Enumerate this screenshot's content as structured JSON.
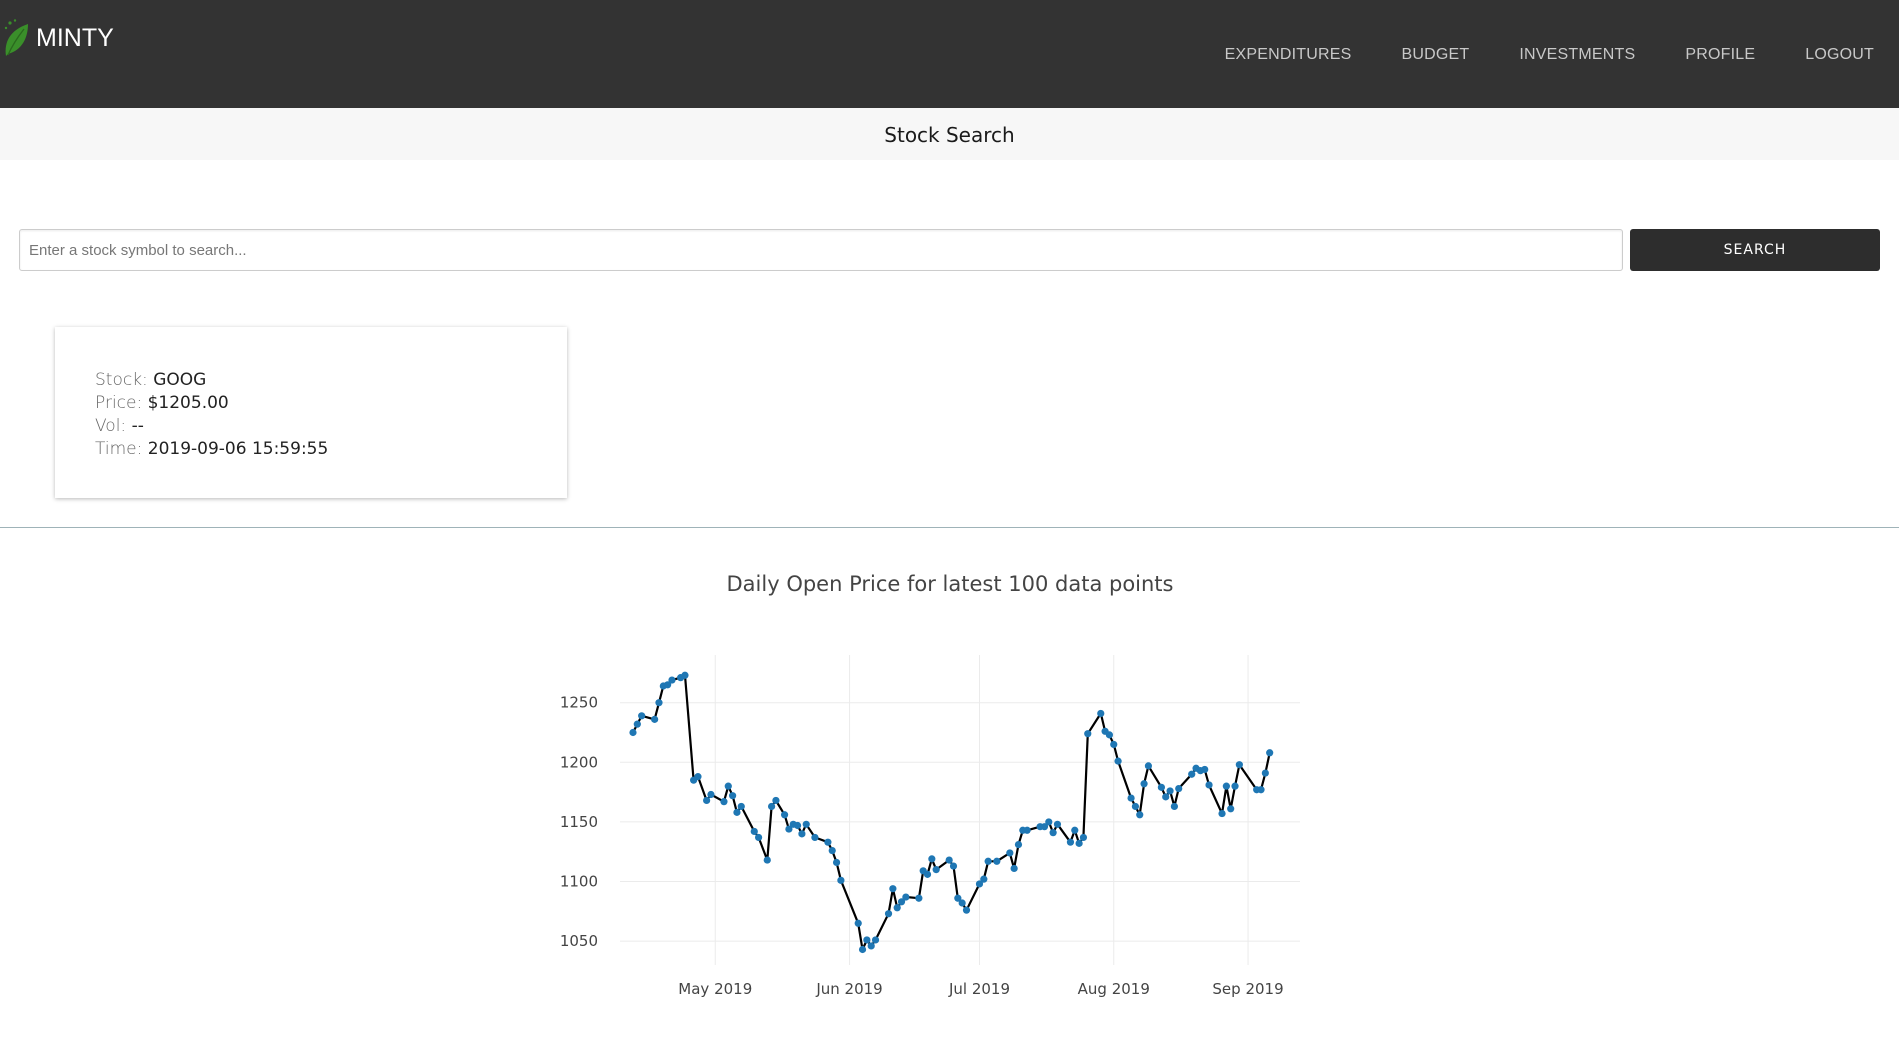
{
  "brand": {
    "name": "MINTY",
    "logo_icon": "leaf-icon",
    "logo_color": "#3a8f2a"
  },
  "nav": {
    "items": [
      {
        "label": "EXPENDITURES"
      },
      {
        "label": "BUDGET"
      },
      {
        "label": "INVESTMENTS"
      },
      {
        "label": "PROFILE"
      },
      {
        "label": "LOGOUT"
      }
    ]
  },
  "page": {
    "title": "Stock Search"
  },
  "search": {
    "placeholder": "Enter a stock symbol to search...",
    "value": "",
    "button_label": "SEARCH"
  },
  "stock_card": {
    "stock_label": "Stock:",
    "stock": "GOOG",
    "price_label": "Price:",
    "price": "$1205.00",
    "vol_label": "Vol:",
    "vol": "--",
    "time_label": "Time:",
    "time": "2019-09-06 15:59:55"
  },
  "colors": {
    "navbar": "#333333",
    "marker": "#1f77b4",
    "line": "#000000",
    "button": "#2d2d2d"
  },
  "chart_data": {
    "type": "line",
    "title": "Daily Open Price for latest 100 data points",
    "xlabel": "",
    "ylabel": "",
    "ylim": [
      1030,
      1290
    ],
    "xlim": [
      "2019-04-09",
      "2019-09-13"
    ],
    "y_ticks": [
      1050,
      1100,
      1150,
      1200,
      1250
    ],
    "x_ticks": [
      {
        "date": "2019-05-01",
        "label": "May 2019"
      },
      {
        "date": "2019-06-01",
        "label": "Jun 2019"
      },
      {
        "date": "2019-07-01",
        "label": "Jul 2019"
      },
      {
        "date": "2019-08-01",
        "label": "Aug 2019"
      },
      {
        "date": "2019-09-01",
        "label": "Sep 2019"
      }
    ],
    "grid": true,
    "series": [
      {
        "markers": true,
        "points": [
          [
            "2019-04-12",
            1225
          ],
          [
            "2019-04-13",
            1232
          ],
          [
            "2019-04-14",
            1239
          ],
          [
            "2019-04-17",
            1236
          ],
          [
            "2019-04-18",
            1250
          ],
          [
            "2019-04-19",
            1264
          ],
          [
            "2019-04-20",
            1265
          ],
          [
            "2019-04-21",
            1269
          ],
          [
            "2019-04-23",
            1271
          ],
          [
            "2019-04-24",
            1273
          ],
          [
            "2019-04-26",
            1185
          ],
          [
            "2019-04-27",
            1188
          ],
          [
            "2019-04-29",
            1168
          ],
          [
            "2019-04-30",
            1173
          ],
          [
            "2019-05-03",
            1167
          ],
          [
            "2019-05-04",
            1180
          ],
          [
            "2019-05-05",
            1172
          ],
          [
            "2019-05-06",
            1158
          ],
          [
            "2019-05-07",
            1163
          ],
          [
            "2019-05-10",
            1142
          ],
          [
            "2019-05-11",
            1137
          ],
          [
            "2019-05-13",
            1118
          ],
          [
            "2019-05-14",
            1163
          ],
          [
            "2019-05-15",
            1168
          ],
          [
            "2019-05-17",
            1156
          ],
          [
            "2019-05-18",
            1144
          ],
          [
            "2019-05-19",
            1148
          ],
          [
            "2019-05-20",
            1147
          ],
          [
            "2019-05-21",
            1140
          ],
          [
            "2019-05-22",
            1148
          ],
          [
            "2019-05-24",
            1137
          ],
          [
            "2019-05-27",
            1133
          ],
          [
            "2019-05-28",
            1126
          ],
          [
            "2019-05-29",
            1116
          ],
          [
            "2019-05-30",
            1101
          ],
          [
            "2019-06-03",
            1065
          ],
          [
            "2019-06-04",
            1043
          ],
          [
            "2019-06-05",
            1051
          ],
          [
            "2019-06-06",
            1046
          ],
          [
            "2019-06-07",
            1051
          ],
          [
            "2019-06-10",
            1073
          ],
          [
            "2019-06-11",
            1094
          ],
          [
            "2019-06-12",
            1078
          ],
          [
            "2019-06-13",
            1083
          ],
          [
            "2019-06-14",
            1087
          ],
          [
            "2019-06-17",
            1086
          ],
          [
            "2019-06-18",
            1109
          ],
          [
            "2019-06-19",
            1106
          ],
          [
            "2019-06-20",
            1119
          ],
          [
            "2019-06-21",
            1110
          ],
          [
            "2019-06-24",
            1118
          ],
          [
            "2019-06-25",
            1113
          ],
          [
            "2019-06-26",
            1086
          ],
          [
            "2019-06-27",
            1082
          ],
          [
            "2019-06-28",
            1076
          ],
          [
            "2019-07-01",
            1098
          ],
          [
            "2019-07-02",
            1102
          ],
          [
            "2019-07-03",
            1117
          ],
          [
            "2019-07-05",
            1117
          ],
          [
            "2019-07-08",
            1124
          ],
          [
            "2019-07-09",
            1111
          ],
          [
            "2019-07-10",
            1131
          ],
          [
            "2019-07-11",
            1143
          ],
          [
            "2019-07-12",
            1143
          ],
          [
            "2019-07-15",
            1146
          ],
          [
            "2019-07-16",
            1146
          ],
          [
            "2019-07-17",
            1150
          ],
          [
            "2019-07-18",
            1141
          ],
          [
            "2019-07-19",
            1148
          ],
          [
            "2019-07-22",
            1133
          ],
          [
            "2019-07-23",
            1143
          ],
          [
            "2019-07-24",
            1132
          ],
          [
            "2019-07-25",
            1137
          ],
          [
            "2019-07-26",
            1224
          ],
          [
            "2019-07-29",
            1241
          ],
          [
            "2019-07-30",
            1226
          ],
          [
            "2019-07-31",
            1223
          ],
          [
            "2019-08-01",
            1215
          ],
          [
            "2019-08-02",
            1201
          ],
          [
            "2019-08-05",
            1170
          ],
          [
            "2019-08-06",
            1163
          ],
          [
            "2019-08-07",
            1156
          ],
          [
            "2019-08-08",
            1182
          ],
          [
            "2019-08-09",
            1197
          ],
          [
            "2019-08-12",
            1179
          ],
          [
            "2019-08-13",
            1171
          ],
          [
            "2019-08-14",
            1176
          ],
          [
            "2019-08-15",
            1163
          ],
          [
            "2019-08-16",
            1178
          ],
          [
            "2019-08-19",
            1190
          ],
          [
            "2019-08-20",
            1195
          ],
          [
            "2019-08-21",
            1193
          ],
          [
            "2019-08-22",
            1194
          ],
          [
            "2019-08-23",
            1181
          ],
          [
            "2019-08-26",
            1157
          ],
          [
            "2019-08-27",
            1180
          ],
          [
            "2019-08-28",
            1161
          ],
          [
            "2019-08-29",
            1180
          ],
          [
            "2019-08-30",
            1198
          ],
          [
            "2019-09-03",
            1177
          ],
          [
            "2019-09-04",
            1177
          ],
          [
            "2019-09-05",
            1191
          ],
          [
            "2019-09-06",
            1208
          ]
        ]
      }
    ]
  }
}
